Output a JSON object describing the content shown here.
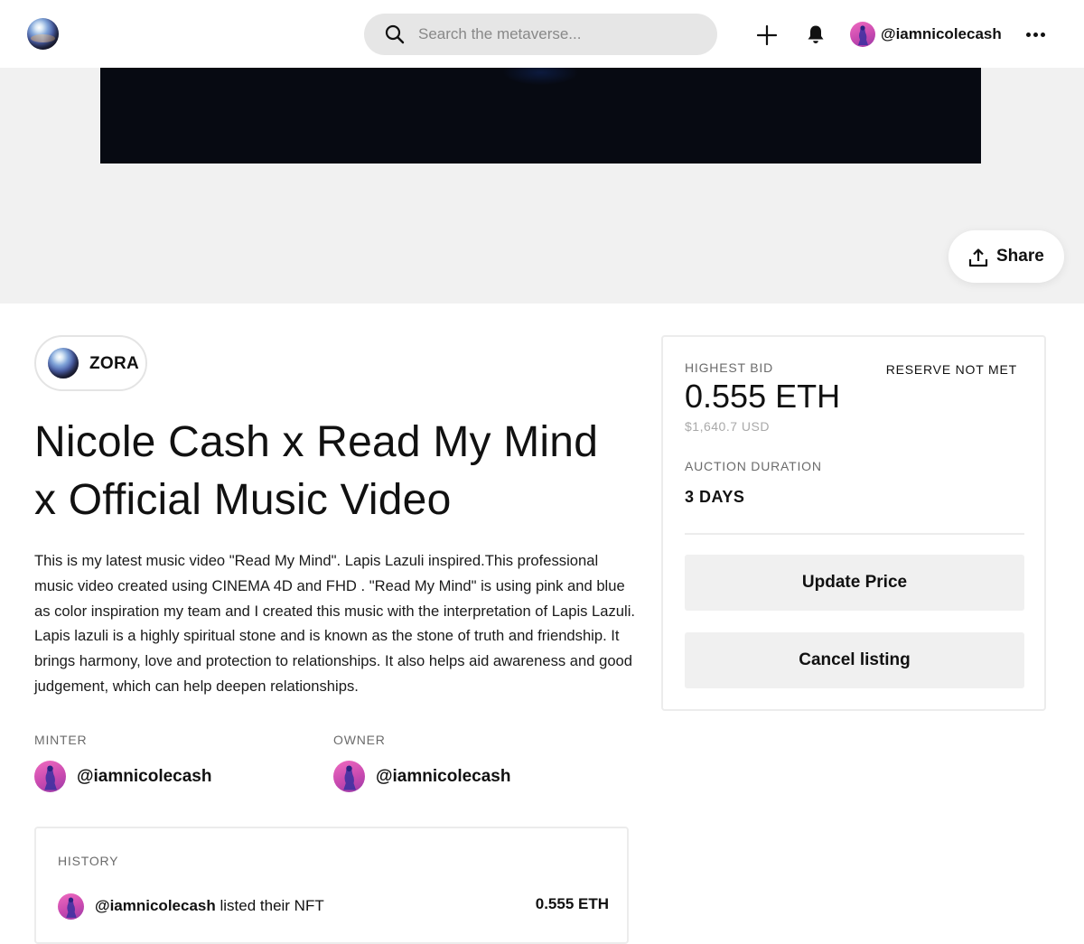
{
  "header": {
    "logo_icon": "zora-orb-logo",
    "search": {
      "placeholder": "Search the metaverse..."
    },
    "create_icon": "plus-icon",
    "notifications_icon": "bell-icon",
    "user": {
      "handle": "@iamnicolecash",
      "avatar_color": "#e25bb8"
    },
    "more_icon": "ellipsis-icon"
  },
  "media": {
    "share_label": "Share",
    "share_icon": "upload-icon"
  },
  "platform_badge": {
    "label": "ZORA"
  },
  "nft": {
    "title": "Nicole Cash x Read My Mind x Official Music Video",
    "description": "This is my latest music video \"Read My Mind\". Lapis Lazuli inspired.This professional music video created using CINEMA 4D and FHD . \"Read My Mind\" is using pink and blue as color inspiration my team and I created this music with the interpretation of Lapis Lazuli. Lapis lazuli is a highly spiritual stone and is known as the stone of truth and friendship. It brings harmony, love and protection to relationships. It also helps aid awareness and good judgement, which can help deepen relationships."
  },
  "minter": {
    "label": "MINTER",
    "handle": "@iamnicolecash"
  },
  "owner": {
    "label": "OWNER",
    "handle": "@iamnicolecash"
  },
  "history": {
    "label": "HISTORY",
    "entries": [
      {
        "handle": "@iamnicolecash",
        "action": "listed their NFT",
        "amount": "0.555 ETH"
      }
    ]
  },
  "auction": {
    "highest_bid_label": "HIGHEST BID",
    "reserve_status": "RESERVE NOT MET",
    "highest_bid": "0.555 ETH",
    "highest_bid_usd": "$1,640.7 USD",
    "duration_label": "AUCTION DURATION",
    "duration": "3 DAYS",
    "update_button": "Update Price",
    "cancel_button": "Cancel listing"
  }
}
